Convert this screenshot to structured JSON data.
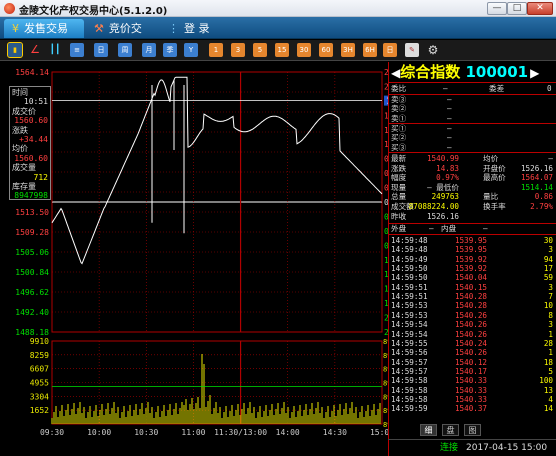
{
  "window": {
    "title": "金陵文化产权交易中心(5.1.2.0)",
    "min_label": "—",
    "max_label": "□",
    "close_label": "✕"
  },
  "tabs": [
    {
      "label": "发售交易",
      "icon": "shopping-icon",
      "active": true
    },
    {
      "label": "竞价交易",
      "icon": "gavel-icon",
      "active": false
    },
    {
      "label": "登 录",
      "icon": "login-icon",
      "active": false
    }
  ],
  "toolbar": {
    "icons": [
      "bar-chart-icon",
      "line-chart-icon",
      "candlestick-icon",
      "list-icon",
      "day-icon",
      "week-icon",
      "month-icon",
      "quarter-icon",
      "year-icon"
    ],
    "small_labels": [
      "日",
      "周",
      "月",
      "季",
      "Y"
    ],
    "intervals": [
      "1",
      "3",
      "5",
      "15",
      "30",
      "60",
      "3H",
      "6H",
      "日"
    ],
    "extra_icons": [
      "draw-icon",
      "gear-icon"
    ]
  },
  "chart": {
    "price_labels_left": [
      "1564.14",
      "1560.60",
      "1552.07",
      "1528.55",
      "1525.23",
      "1521.94",
      "1517.72",
      "1513.50",
      "1509.28",
      "1505.06",
      "1500.84",
      "1496.62",
      "1492.40",
      "1488.18"
    ],
    "pct_labels_right": [
      "2.49%",
      "2.21%",
      "1.94%",
      "1.66%",
      "1.38%",
      "1.11%",
      "0.83%",
      "0.55%",
      "0.28%",
      "0.00%",
      "0.28%",
      "0.55%",
      "0.83%",
      "1.11%",
      "1.38%",
      "1.66%",
      "1.94%",
      "2.21%",
      "2.49%"
    ],
    "current_price_tag": "1559.6",
    "volume_labels_left": [
      "9910",
      "8259",
      "6607",
      "4955",
      "3304",
      "1652"
    ],
    "volume_labels_right": [
      "8948003",
      "8948002",
      "8948001",
      "8948000",
      "8947999",
      "8947998",
      "8947997"
    ],
    "time_labels": [
      "09:30",
      "10:00",
      "10:30",
      "11:00",
      "11:30/13:00",
      "14:00",
      "14:30",
      "15:00"
    ],
    "colors": {
      "up": "#ff4040",
      "down": "#00e000",
      "grid": "#b00000",
      "line": "#ffffff",
      "volume": "#e8e800"
    }
  },
  "infobox": {
    "time_label": "时间",
    "time": "10:51",
    "price_label": "成交价",
    "price": "1560.60",
    "change_label": "涨跌",
    "change": "+34.44",
    "avg_label": "均价",
    "avg": "1560.60",
    "vol_label": "成交量",
    "vol": "712",
    "stock_label": "库存量",
    "stock": "8947998"
  },
  "panel": {
    "title_name": "综合指数",
    "title_code": "100001",
    "weibi_label": "委比",
    "weibi_value": "—",
    "weicha_label": "委差",
    "weicha_value": "0",
    "sells": [
      {
        "label": "卖③",
        "price": "—",
        "vol": ""
      },
      {
        "label": "卖②",
        "price": "—",
        "vol": ""
      },
      {
        "label": "卖①",
        "price": "—",
        "vol": ""
      }
    ],
    "buys": [
      {
        "label": "买①",
        "price": "—",
        "vol": ""
      },
      {
        "label": "买②",
        "price": "—",
        "vol": ""
      },
      {
        "label": "买③",
        "price": "—",
        "vol": ""
      }
    ],
    "quote": [
      {
        "l1": "最新",
        "v1": "1540.99",
        "l2": "均价",
        "v2": "—"
      },
      {
        "l1": "涨跌",
        "v1": "14.83",
        "l2": "开盘价",
        "v2": "1526.16"
      },
      {
        "l1": "幅度",
        "v1": "0.97%",
        "l2": "最高价",
        "v2": "1564.07"
      },
      {
        "l1": "现量",
        "v1": "— 最低价",
        "l2": "",
        "v2": "1514.14"
      },
      {
        "l1": "总量",
        "v1": "249763",
        "l2": "量比",
        "v2": "0.86"
      },
      {
        "l1": "成交额",
        "v1": "87088224.00",
        "l2": "换手率",
        "v2": "2.79%"
      },
      {
        "l1": "昨收",
        "v1": "1526.16",
        "l2": "",
        "v2": ""
      }
    ],
    "outer_label": "外盘",
    "outer_value": "—",
    "inner_label": "内盘",
    "inner_value": "—",
    "ticks": [
      {
        "time": "14:59:48",
        "price": "1539.95",
        "vol": "30"
      },
      {
        "time": "14:59:48",
        "price": "1539.95",
        "vol": "3"
      },
      {
        "time": "14:59:49",
        "price": "1539.92",
        "vol": "94"
      },
      {
        "time": "14:59:50",
        "price": "1539.92",
        "vol": "17"
      },
      {
        "time": "14:59:50",
        "price": "1540.04",
        "vol": "59"
      },
      {
        "time": "14:59:51",
        "price": "1540.15",
        "vol": "3"
      },
      {
        "time": "14:59:51",
        "price": "1540.28",
        "vol": "7"
      },
      {
        "time": "14:59:53",
        "price": "1540.28",
        "vol": "10"
      },
      {
        "time": "14:59:53",
        "price": "1540.26",
        "vol": "8"
      },
      {
        "time": "14:59:54",
        "price": "1540.26",
        "vol": "3"
      },
      {
        "time": "14:59:54",
        "price": "1540.26",
        "vol": "1"
      },
      {
        "time": "14:59:55",
        "price": "1540.24",
        "vol": "28"
      },
      {
        "time": "14:59:56",
        "price": "1540.26",
        "vol": "1"
      },
      {
        "time": "14:59:57",
        "price": "1540.12",
        "vol": "18"
      },
      {
        "time": "14:59:57",
        "price": "1540.17",
        "vol": "5"
      },
      {
        "time": "14:59:58",
        "price": "1540.33",
        "vol": "100"
      },
      {
        "time": "14:59:58",
        "price": "1540.33",
        "vol": "13"
      },
      {
        "time": "14:59:58",
        "price": "1540.33",
        "vol": "4"
      },
      {
        "time": "14:59:59",
        "price": "1540.37",
        "vol": "14"
      }
    ],
    "bottom_tabs": [
      "细",
      "盘",
      "图"
    ]
  },
  "status": {
    "connection": "连接",
    "datetime": "2017-04-15 15:00"
  }
}
